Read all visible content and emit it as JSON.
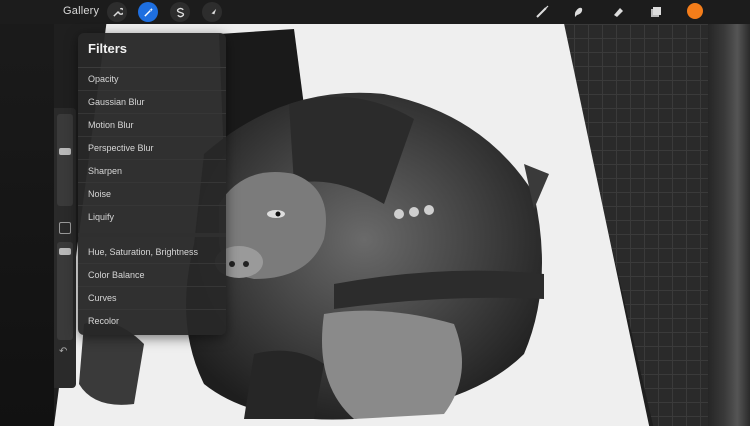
{
  "topbar": {
    "gallery_label": "Gallery",
    "left_tools": [
      {
        "icon": "wrench-icon"
      },
      {
        "icon": "magic-wand-icon",
        "active": true
      },
      {
        "icon": "selection-s-icon"
      },
      {
        "icon": "arrow-cursor-icon"
      }
    ],
    "right_tools": [
      {
        "icon": "brush-icon"
      },
      {
        "icon": "smudge-icon"
      },
      {
        "icon": "eraser-icon"
      },
      {
        "icon": "layers-icon"
      }
    ],
    "current_color": "#f47d1a",
    "accent_color": "#1e6fe0"
  },
  "filters_menu": {
    "title": "Filters",
    "group1": [
      "Opacity",
      "Gaussian Blur",
      "Motion Blur",
      "Perspective Blur",
      "Sharpen",
      "Noise",
      "Liquify"
    ],
    "group2": [
      "Hue, Saturation, Brightness",
      "Color Balance",
      "Curves",
      "Recolor"
    ]
  }
}
